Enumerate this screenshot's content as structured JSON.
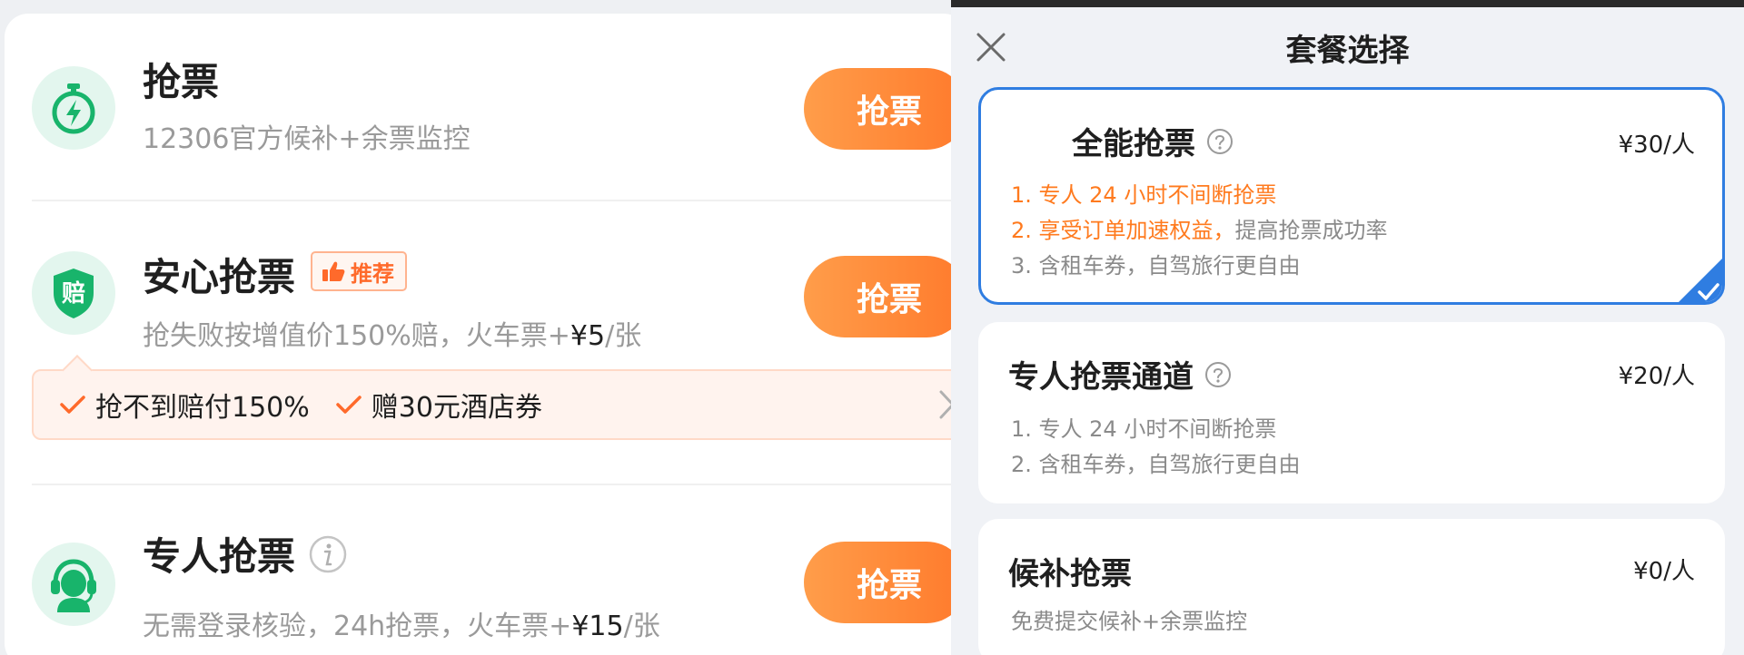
{
  "left": {
    "items": [
      {
        "title": "抢票",
        "subtitle": "12306官方候补+余票监控",
        "button": "抢票",
        "icon": "stopwatch-lightning-icon"
      },
      {
        "title": "安心抢票",
        "badge": "推荐",
        "subtitle_prefix": "抢失败按增值价150%赔，火车票+",
        "subtitle_price": "¥5",
        "subtitle_suffix": "/张",
        "button": "抢票",
        "icon": "compensation-shield-icon",
        "icon_text": "赔",
        "benefits": [
          "抢不到赔付150%",
          "赠30元酒店券"
        ]
      },
      {
        "title": "专人抢票",
        "subtitle_prefix": "无需登录核验，24h抢票，火车票+",
        "subtitle_price": "¥15",
        "subtitle_suffix": "/张",
        "button": "抢票",
        "icon": "customer-service-headset-icon"
      }
    ]
  },
  "sheet": {
    "title": "套餐选择",
    "plans": [
      {
        "name": "全能抢票",
        "price": "¥30/人",
        "selected": true,
        "lines": [
          "1. 专人 24 小时不间断抢票",
          "2. 享受订单加速权益，",
          "提高抢票成功率",
          "3. 含租车券，自驾旅行更自由"
        ]
      },
      {
        "name": "专人抢票通道",
        "price": "¥20/人",
        "selected": false,
        "lines": [
          "1. 专人 24 小时不间断抢票",
          "2. 含租车券，自驾旅行更自由"
        ]
      },
      {
        "name": "候补抢票",
        "price": "¥0/人",
        "selected": false,
        "lines": [
          "免费提交候补+余票监控"
        ]
      }
    ]
  },
  "colors": {
    "accent_orange": "#ff7a2c",
    "brand_green": "#18b46b",
    "selected_blue": "#2f7de1"
  }
}
